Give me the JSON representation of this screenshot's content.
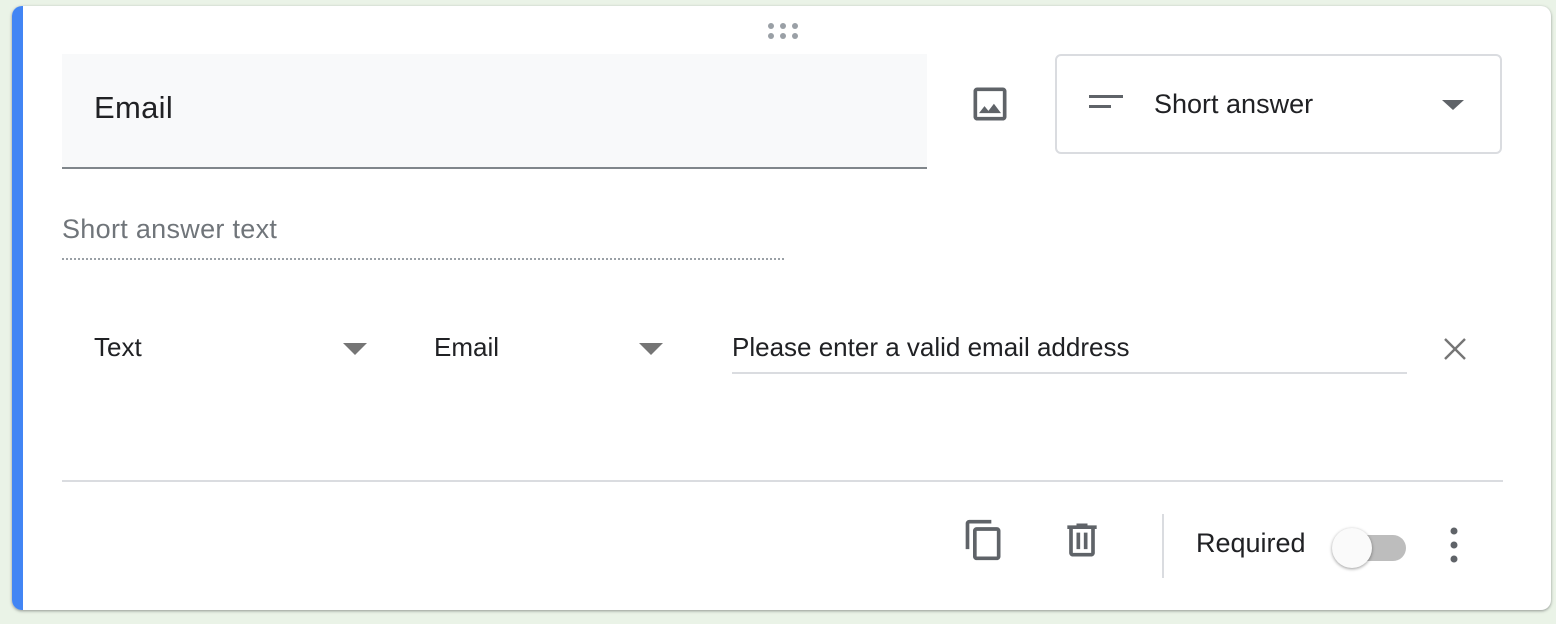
{
  "question": {
    "title": "Email"
  },
  "icons": {
    "drag": "drag-handle-icon",
    "image": "image-icon",
    "type": "short-answer-icon",
    "close": "close-icon",
    "duplicate": "duplicate-icon",
    "delete": "delete-icon",
    "more": "more-vert-icon"
  },
  "type_select": {
    "selected": "Short answer"
  },
  "answer": {
    "placeholder": "Short answer text"
  },
  "validation": {
    "category": "Text",
    "rule": "Email",
    "error_text": "Please enter a valid email address"
  },
  "footer": {
    "required_label": "Required",
    "required_on": false
  },
  "colors": {
    "accent": "#4285f4",
    "icon": "#5f6368",
    "divider": "#dadce0",
    "title_bg": "#f8f9fa"
  }
}
